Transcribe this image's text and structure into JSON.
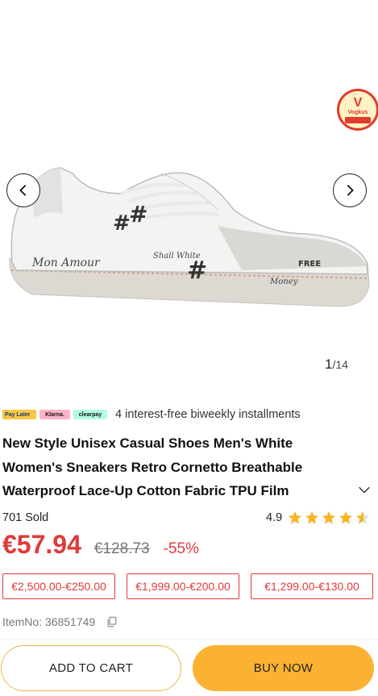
{
  "gallery": {
    "current": "1",
    "total": "/14",
    "promo_badge": "Vogkus"
  },
  "payment": {
    "logos": [
      "Pay Later",
      "Klarna.",
      "clearpay"
    ],
    "text": "4 interest-free biweekly installments"
  },
  "product": {
    "title": "New Style Unisex Casual Shoes Men's White Women's Sneakers Retro Cornetto Breathable Waterproof Lace-Up Cotton Fabric TPU Film",
    "sold": "701 Sold",
    "rating": "4.9",
    "rating_value": 4.9,
    "price": "€57.94",
    "original_price": "€128.73",
    "discount": "-55%",
    "item_no": "ItemNo: 36851749"
  },
  "coupons": [
    "€2,500.00-€250.00",
    "€1,999.00-€200.00",
    "€1,299.00-€130.00"
  ],
  "actions": {
    "add_to_cart": "ADD TO CART",
    "buy_now": "BUY NOW"
  },
  "colors": {
    "price_red": "#e03a3a",
    "buy_yellow": "#fbb233",
    "star_yellow": "#f5b623"
  }
}
